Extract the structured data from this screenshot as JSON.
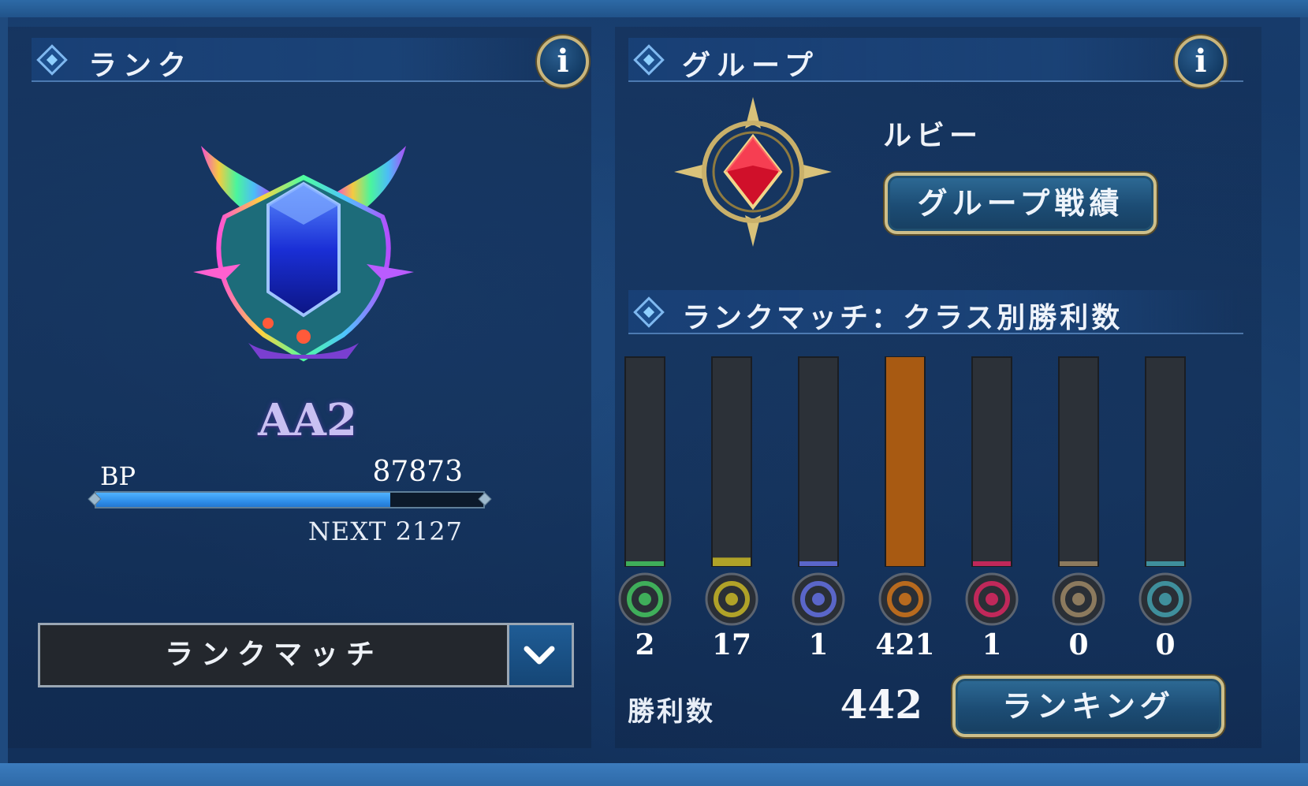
{
  "rank": {
    "section_title": "ランク",
    "name": "AA2",
    "bp_label": "BP",
    "bp_value": "87873",
    "bp_progress": 0.76,
    "next_text": "NEXT 2127",
    "mode_select": {
      "selected": "ランクマッチ",
      "toggle_icon": "chevron-down-icon"
    },
    "info_icon": "info-icon"
  },
  "group": {
    "section_title": "グループ",
    "name": "ルビー",
    "record_button": "グループ戦績",
    "info_icon": "info-icon"
  },
  "class_wins": {
    "section_title": "ランクマッチ：クラス別勝利数",
    "total_label": "勝利数",
    "total_value": "442",
    "ranking_button": "ランキング",
    "classes": [
      {
        "icon": "leaf-icon",
        "count": "2",
        "color": "#3fae5a"
      },
      {
        "icon": "crown-icon",
        "count": "17",
        "color": "#b0a228"
      },
      {
        "icon": "hexagram-icon",
        "count": "1",
        "color": "#5a66c9"
      },
      {
        "icon": "dragon-icon",
        "count": "421",
        "color": "#b86a1e"
      },
      {
        "icon": "demon-icon",
        "count": "1",
        "color": "#c0285a"
      },
      {
        "icon": "wings-icon",
        "count": "0",
        "color": "#8c7a5e"
      },
      {
        "icon": "portal-icon",
        "count": "0",
        "color": "#3f8f9c"
      }
    ]
  },
  "chart_data": {
    "type": "bar",
    "categories": [
      "leaf-icon",
      "crown-icon",
      "hexagram-icon",
      "dragon-icon",
      "demon-icon",
      "wings-icon",
      "portal-icon"
    ],
    "values": [
      2,
      17,
      1,
      421,
      1,
      0,
      0
    ],
    "title": "ランクマッチ：クラス別勝利数",
    "xlabel": "",
    "ylabel": "",
    "ylim": [
      0,
      421
    ],
    "grid": false
  }
}
